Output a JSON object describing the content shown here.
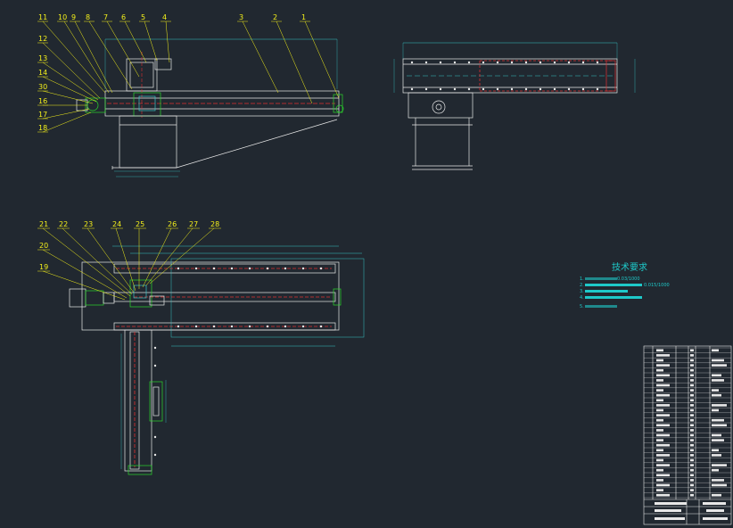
{
  "drawing": {
    "background": "#212830",
    "line_color": "#e8e8e8",
    "leader_color": "#f4f01a",
    "dim_color": "#39c4c4",
    "red_color": "#e03030",
    "green_color": "#2ad62a"
  },
  "front_view_labels": [
    "11",
    "10",
    "9",
    "8",
    "7",
    "6",
    "5",
    "4",
    "3",
    "2",
    "1"
  ],
  "front_view_left_labels": [
    "12",
    "13",
    "14",
    "30",
    "16",
    "17",
    "18"
  ],
  "plan_view_labels": [
    "21",
    "22",
    "23",
    "24",
    "25",
    "26",
    "27",
    "28"
  ],
  "plan_view_left_labels": [
    "20",
    "19"
  ],
  "technical_requirements": {
    "title": "技术要求",
    "items": [
      "1.",
      "2.",
      "3.",
      "4.",
      "5."
    ],
    "values": [
      "0.03/1000",
      "0.015/1000"
    ]
  }
}
